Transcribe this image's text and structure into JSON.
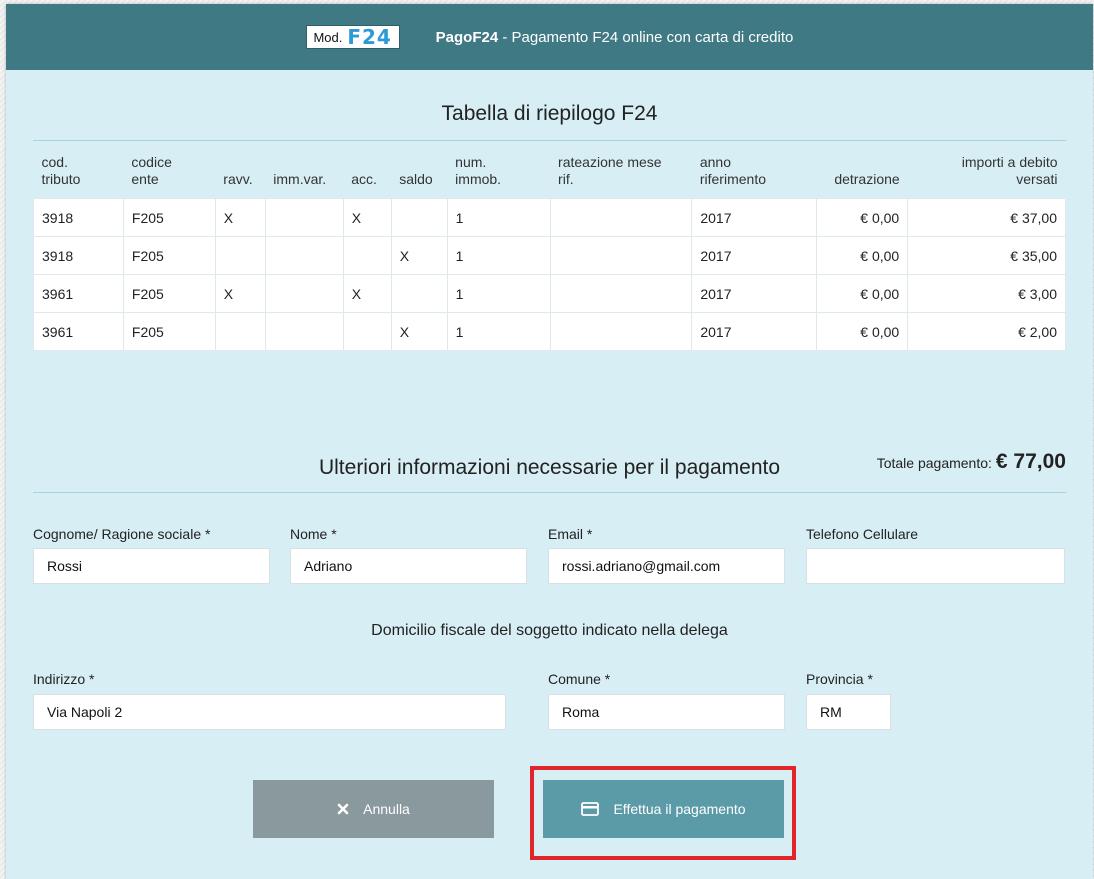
{
  "header": {
    "logo_mod": "Mod.",
    "logo_f24": "F24",
    "brand": "PagoF24",
    "tagline": " - Pagamento F24 online con carta di credito"
  },
  "summary": {
    "title": "Tabella di riepilogo F24",
    "columns": {
      "cod_tributo": [
        "cod.",
        "tributo"
      ],
      "codice_ente": [
        "codice",
        "ente"
      ],
      "ravv": "ravv.",
      "imm_var": "imm.var.",
      "acc": "acc.",
      "saldo": "saldo",
      "num_immob": [
        "num.",
        "immob."
      ],
      "rateazione": [
        "rateazione mese",
        "rif."
      ],
      "anno": [
        "anno",
        "riferimento"
      ],
      "detrazione": "detrazione",
      "importi": [
        "importi a debito",
        "versati"
      ]
    },
    "rows": [
      {
        "cod_tributo": "3918",
        "codice_ente": "F205",
        "ravv": "X",
        "imm_var": "",
        "acc": "X",
        "saldo": "",
        "num_immob": "1",
        "rateazione": "",
        "anno": "2017",
        "detrazione": "€ 0,00",
        "importo": "€ 37,00"
      },
      {
        "cod_tributo": "3918",
        "codice_ente": "F205",
        "ravv": "",
        "imm_var": "",
        "acc": "",
        "saldo": "X",
        "num_immob": "1",
        "rateazione": "",
        "anno": "2017",
        "detrazione": "€ 0,00",
        "importo": "€ 35,00"
      },
      {
        "cod_tributo": "3961",
        "codice_ente": "F205",
        "ravv": "X",
        "imm_var": "",
        "acc": "X",
        "saldo": "",
        "num_immob": "1",
        "rateazione": "",
        "anno": "2017",
        "detrazione": "€ 0,00",
        "importo": "€ 3,00"
      },
      {
        "cod_tributo": "3961",
        "codice_ente": "F205",
        "ravv": "",
        "imm_var": "",
        "acc": "",
        "saldo": "X",
        "num_immob": "1",
        "rateazione": "",
        "anno": "2017",
        "detrazione": "€ 0,00",
        "importo": "€ 2,00"
      }
    ],
    "total_label": "Totale pagamento:",
    "total_amount": "€ 77,00"
  },
  "info": {
    "title": "Ulteriori informazioni necessarie per il pagamento",
    "cognome_label": "Cognome/ Ragione sociale *",
    "cognome_value": "Rossi",
    "nome_label": "Nome *",
    "nome_value": "Adriano",
    "email_label": "Email *",
    "email_value": "rossi.adriano@gmail.com",
    "telefono_label": "Telefono Cellulare",
    "telefono_value": "",
    "domicilio_title": "Domicilio fiscale del soggetto indicato nella delega",
    "indirizzo_label": "Indirizzo *",
    "indirizzo_value": "Via Napoli 2",
    "comune_label": "Comune *",
    "comune_value": "Roma",
    "provincia_label": "Provincia *",
    "provincia_value": "RM"
  },
  "actions": {
    "cancel_label": "Annulla",
    "cancel_icon": "close-icon",
    "pay_label": "Effettua il pagamento",
    "pay_icon": "credit-card-icon"
  },
  "colors": {
    "header": "#3f7a84",
    "background": "#d7eef4",
    "cancel_button": "#8a999e",
    "pay_button": "#5b9aa7",
    "highlight": "#e0262a"
  }
}
